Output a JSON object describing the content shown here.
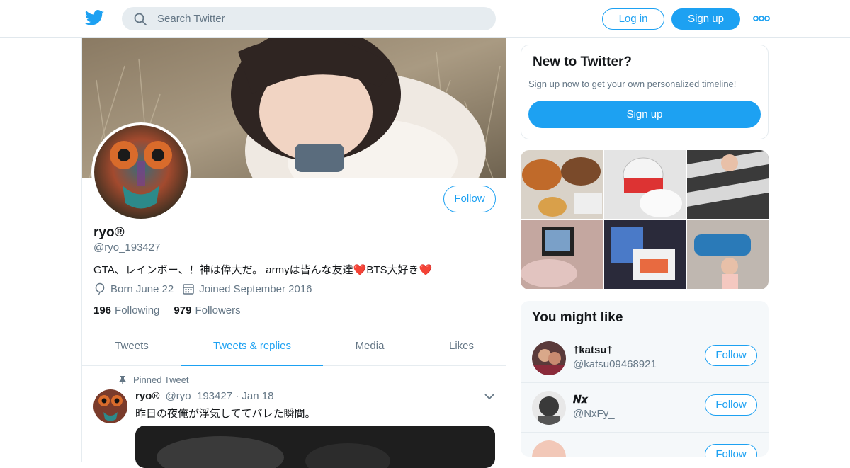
{
  "brand": {
    "accent": "#1da1f2",
    "logo_icon": "twitter-bird-icon"
  },
  "header": {
    "search_placeholder": "Search Twitter",
    "login_label": "Log in",
    "signup_label": "Sign up",
    "more_icon": "more-dots-icon"
  },
  "profile": {
    "name": "ryo®",
    "handle": "@ryo_193427",
    "bio_text": "GTA、レインボー、！神は偉大だ。 armyは皆んな友達",
    "bio_heart_1": "❤️",
    "bio_text_2": "BTS大好き",
    "bio_heart_2": "❤️",
    "born": "Born June 22",
    "joined": "Joined September 2016",
    "following_count": "196",
    "following_label": "Following",
    "followers_count": "979",
    "followers_label": "Followers",
    "follow_label": "Follow"
  },
  "tabs": [
    {
      "label": "Tweets"
    },
    {
      "label": "Tweets & replies"
    },
    {
      "label": "Media"
    },
    {
      "label": "Likes"
    }
  ],
  "pinned_tweet": {
    "pinned_label": "Pinned Tweet",
    "author_name": "ryo®",
    "author_handle": "@ryo_193427",
    "separator": "·",
    "date": "Jan 18",
    "text": "昨日の夜俺が浮気しててバレた瞬間。"
  },
  "new_to_twitter": {
    "title": "New to Twitter?",
    "subtitle": "Sign up now to get your own personalized timeline!",
    "signup_label": "Sign up"
  },
  "you_might_like": {
    "title": "You might like",
    "accounts": [
      {
        "name": "†katsu†",
        "handle": "@katsu09468921",
        "follow_label": "Follow"
      },
      {
        "name": "𝑵𝒙",
        "handle": "@NxFy_",
        "follow_label": "Follow"
      },
      {
        "name": "",
        "handle": "",
        "follow_label": "Follow"
      }
    ]
  }
}
